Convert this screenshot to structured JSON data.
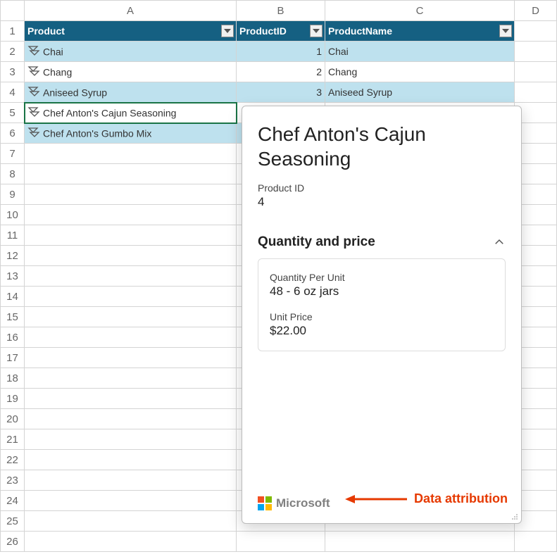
{
  "columns": {
    "A": "A",
    "B": "B",
    "C": "C",
    "D": "D"
  },
  "rowNumbers": [
    "1",
    "2",
    "3",
    "4",
    "5",
    "6",
    "7",
    "8",
    "9",
    "10",
    "11",
    "12",
    "13",
    "14",
    "15",
    "16",
    "17",
    "18",
    "19",
    "20",
    "21",
    "22",
    "23",
    "24",
    "25",
    "26"
  ],
  "tableHeaders": {
    "product": "Product",
    "productId": "ProductID",
    "productName": "ProductName"
  },
  "rows": [
    {
      "product": "Chai",
      "id": "1",
      "name": "Chai",
      "band": "even"
    },
    {
      "product": "Chang",
      "id": "2",
      "name": "Chang",
      "band": "odd"
    },
    {
      "product": "Aniseed Syrup",
      "id": "3",
      "name": "Aniseed Syrup",
      "band": "even"
    },
    {
      "product": "Chef Anton's Cajun Seasoning",
      "id": "",
      "name": "",
      "band": "odd",
      "selected": true
    },
    {
      "product": "Chef Anton's Gumbo Mix",
      "id": "",
      "name": "",
      "band": "even"
    }
  ],
  "card": {
    "title": "Chef Anton's Cajun Seasoning",
    "productIdLabel": "Product ID",
    "productIdValue": "4",
    "sectionTitle": "Quantity and price",
    "qtyLabel": "Quantity Per Unit",
    "qtyValue": "48 - 6 oz jars",
    "priceLabel": "Unit Price",
    "priceValue": "$22.00",
    "attribution": "Microsoft"
  },
  "annotation": "Data attribution"
}
